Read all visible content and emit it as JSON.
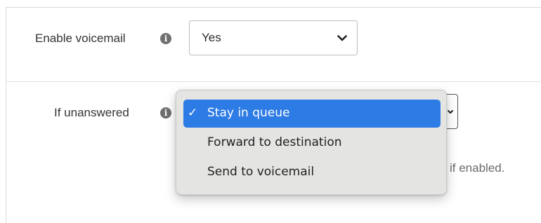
{
  "form": {
    "enable_voicemail": {
      "label": "Enable voicemail",
      "info_icon": "info-icon",
      "value": "Yes",
      "chevron_icon": "chevron-down-icon"
    },
    "if_unanswered": {
      "label": "If unanswered",
      "info_icon": "info-icon",
      "selected_value": "Stay in queue",
      "options": [
        {
          "label": "Stay in queue",
          "selected": true,
          "check_mark": "✓"
        },
        {
          "label": "Forward to destination",
          "selected": false
        },
        {
          "label": "Send to voicemail",
          "selected": false
        }
      ]
    },
    "help_text_fragment": "if enabled."
  },
  "colors": {
    "accent": "#2d7be5",
    "popup_background": "#e4e5e3",
    "info_icon": "#6f6f6f"
  }
}
